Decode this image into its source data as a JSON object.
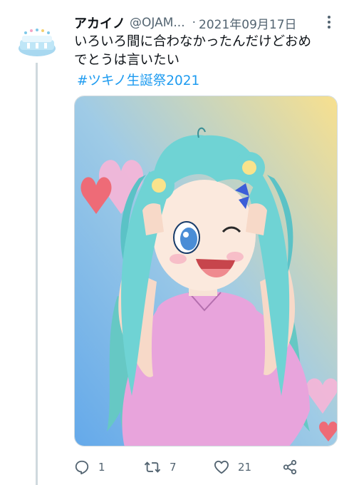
{
  "tweet": {
    "display_name": "アカイノ",
    "handle": "@OJAM...",
    "separator": "·",
    "timestamp": "2021年09月17日",
    "text_lines": [
      "いろいろ間に合わなかったんだけどおめ",
      "でとうは言いたい"
    ],
    "hashtag": "#ツキノ生誕祭2021"
  },
  "actions": {
    "reply_count": "1",
    "retweet_count": "7",
    "like_count": "21"
  },
  "icons": {
    "more": "more-vertical-icon",
    "reply": "reply-icon",
    "retweet": "retweet-icon",
    "like": "heart-icon",
    "share": "share-icon"
  },
  "colors": {
    "text": "#0f1419",
    "secondary": "#536471",
    "link": "#1d9bf0",
    "thread_line": "#cfd9de"
  }
}
